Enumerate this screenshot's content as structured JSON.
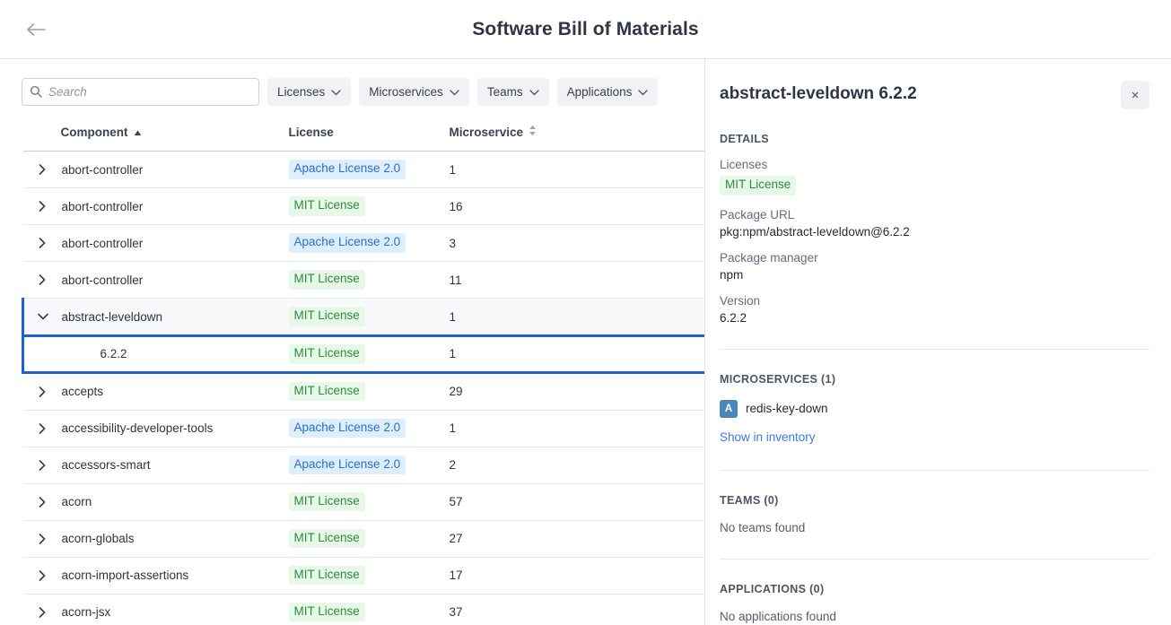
{
  "header": {
    "title": "Software Bill of Materials",
    "back_icon": "arrow-left-icon"
  },
  "toolbar": {
    "search_placeholder": "Search",
    "search_value": "",
    "search_icon": "search-icon",
    "filters": [
      {
        "label": "Licenses",
        "icon": "chevron-down-icon"
      },
      {
        "label": "Microservices",
        "icon": "chevron-down-icon"
      },
      {
        "label": "Teams",
        "icon": "chevron-down-icon"
      },
      {
        "label": "Applications",
        "icon": "chevron-down-icon"
      }
    ]
  },
  "table": {
    "columns": [
      {
        "key": "component",
        "label": "Component",
        "sort": "asc"
      },
      {
        "key": "license",
        "label": "License",
        "sort": "none"
      },
      {
        "key": "microservice",
        "label": "Microservice",
        "sort": "sortable"
      }
    ],
    "rows": [
      {
        "component": "abort-controller",
        "license": "Apache License 2.0",
        "license_type": "apache",
        "microservice": "1",
        "state": "collapsed"
      },
      {
        "component": "abort-controller",
        "license": "MIT License",
        "license_type": "mit",
        "microservice": "16",
        "state": "collapsed"
      },
      {
        "component": "abort-controller",
        "license": "Apache License 2.0",
        "license_type": "apache",
        "microservice": "3",
        "state": "collapsed"
      },
      {
        "component": "abort-controller",
        "license": "MIT License",
        "license_type": "mit",
        "microservice": "11",
        "state": "collapsed"
      },
      {
        "component": "abstract-leveldown",
        "license": "MIT License",
        "license_type": "mit",
        "microservice": "1",
        "state": "expanded"
      },
      {
        "component": "6.2.2",
        "license": "MIT License",
        "license_type": "mit",
        "microservice": "1",
        "state": "child"
      },
      {
        "component": "accepts",
        "license": "MIT License",
        "license_type": "mit",
        "microservice": "29",
        "state": "collapsed"
      },
      {
        "component": "accessibility-developer-tools",
        "license": "Apache License 2.0",
        "license_type": "apache",
        "microservice": "1",
        "state": "collapsed"
      },
      {
        "component": "accessors-smart",
        "license": "Apache License 2.0",
        "license_type": "apache",
        "microservice": "2",
        "state": "collapsed"
      },
      {
        "component": "acorn",
        "license": "MIT License",
        "license_type": "mit",
        "microservice": "57",
        "state": "collapsed"
      },
      {
        "component": "acorn-globals",
        "license": "MIT License",
        "license_type": "mit",
        "microservice": "27",
        "state": "collapsed"
      },
      {
        "component": "acorn-import-assertions",
        "license": "MIT License",
        "license_type": "mit",
        "microservice": "17",
        "state": "collapsed"
      },
      {
        "component": "acorn-jsx",
        "license": "MIT License",
        "license_type": "mit",
        "microservice": "37",
        "state": "collapsed"
      }
    ]
  },
  "detail": {
    "title": "abstract-leveldown 6.2.2",
    "close_label": "×",
    "details_heading": "DETAILS",
    "fields": [
      {
        "label": "Licenses",
        "badge": "MIT License",
        "badge_type": "mit"
      },
      {
        "label": "Package URL",
        "value": "pkg:npm/abstract-leveldown@6.2.2"
      },
      {
        "label": "Package manager",
        "value": "npm"
      },
      {
        "label": "Version",
        "value": "6.2.2"
      }
    ],
    "microservices": {
      "heading": "MICROSERVICES (1)",
      "items": [
        {
          "avatar": "A",
          "name": "redis-key-down"
        }
      ],
      "link": "Show in inventory"
    },
    "teams": {
      "heading": "TEAMS (0)",
      "empty": "No teams found"
    },
    "applications": {
      "heading": "APPLICATIONS (0)",
      "empty": "No applications found"
    }
  },
  "colors": {
    "accent": "#2160d4",
    "link": "#3b7ae0",
    "mit_bg": "#e7f8e9",
    "mit_fg": "#2f8a3e",
    "apache_bg": "#ddeeff",
    "apache_fg": "#2a6fc9",
    "avatar_bg": "#4a86b8"
  }
}
